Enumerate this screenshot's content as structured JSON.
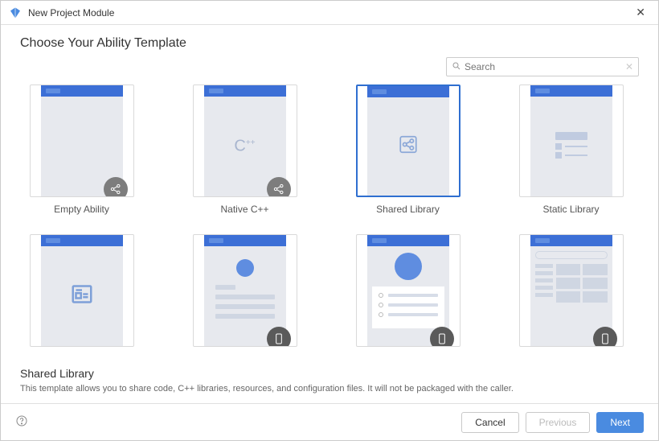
{
  "window": {
    "title": "New Project Module"
  },
  "heading": "Choose Your Ability Template",
  "search": {
    "placeholder": "Search"
  },
  "templates": [
    {
      "id": "empty-ability",
      "label": "Empty Ability"
    },
    {
      "id": "native-cpp",
      "label": "Native C++"
    },
    {
      "id": "shared-library",
      "label": "Shared Library"
    },
    {
      "id": "static-library",
      "label": "Static Library"
    },
    {
      "id": "news-ability",
      "label": ""
    },
    {
      "id": "login-ability",
      "label": ""
    },
    {
      "id": "about-ability",
      "label": ""
    },
    {
      "id": "category-ability",
      "label": ""
    }
  ],
  "selected_template_index": 2,
  "description": {
    "title": "Shared Library",
    "text": "This template allows you to share code, C++ libraries, resources, and configuration files. It will not be packaged with the caller."
  },
  "buttons": {
    "cancel": "Cancel",
    "previous": "Previous",
    "next": "Next",
    "previous_enabled": false
  }
}
